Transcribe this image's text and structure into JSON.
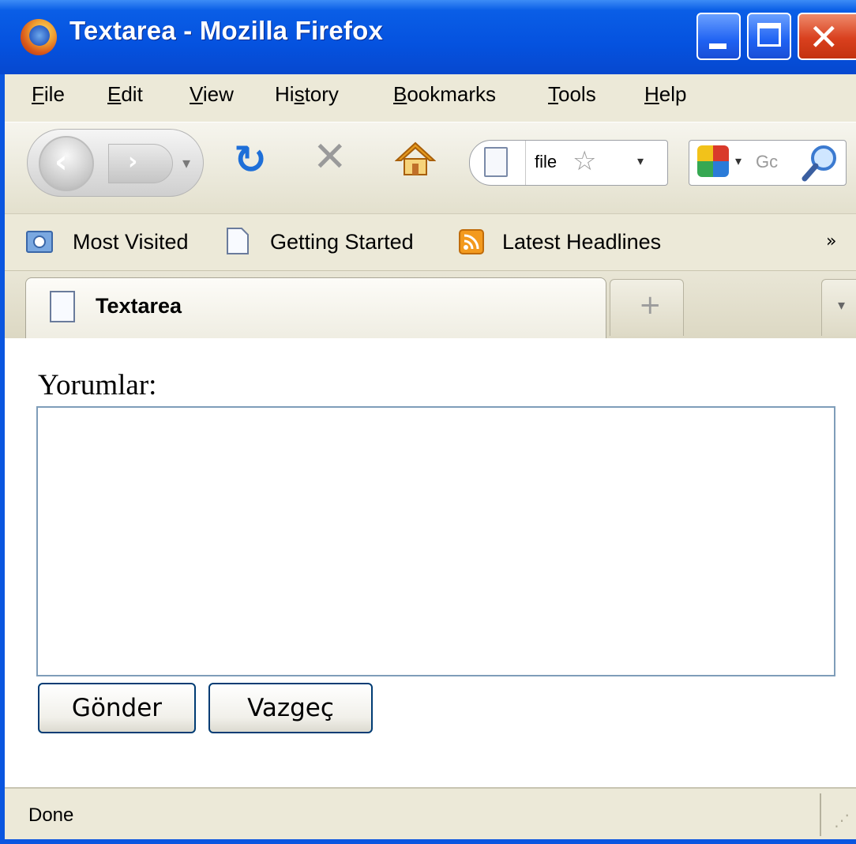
{
  "window": {
    "title": "Textarea - Mozilla Firefox"
  },
  "menu": {
    "items": [
      {
        "pre": "",
        "u": "F",
        "post": "ile"
      },
      {
        "pre": "",
        "u": "E",
        "post": "dit"
      },
      {
        "pre": "",
        "u": "V",
        "post": "iew"
      },
      {
        "pre": "Hi",
        "u": "s",
        "post": "tory"
      },
      {
        "pre": "",
        "u": "B",
        "post": "ookmarks"
      },
      {
        "pre": "",
        "u": "T",
        "post": "ools"
      },
      {
        "pre": "",
        "u": "H",
        "post": "elp"
      }
    ]
  },
  "navbar": {
    "url_value": "file",
    "search_placeholder": "Gc"
  },
  "bookmarks": {
    "items": [
      "Most Visited",
      "Getting Started",
      "Latest Headlines"
    ],
    "overflow": "»"
  },
  "tabs": {
    "active_label": "Textarea",
    "new_tab_glyph": "+"
  },
  "form": {
    "label": "Yorumlar:",
    "textarea_value": "",
    "submit_label": "Gönder",
    "cancel_label": "Vazgeç"
  },
  "status": {
    "text": "Done"
  },
  "colors": {
    "titlebar": "#0552df",
    "chrome_bg": "#ece9d8",
    "textarea_border": "#7f9db9",
    "button_border": "#003c74"
  }
}
